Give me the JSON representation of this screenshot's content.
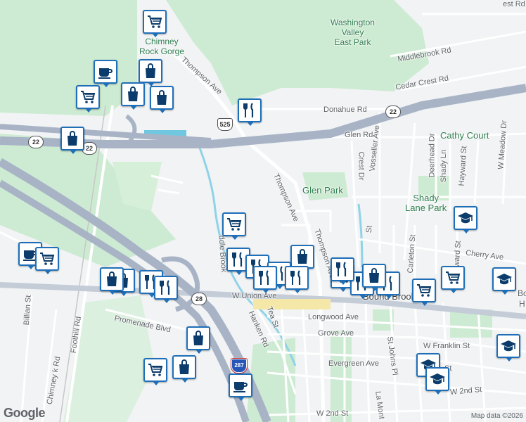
{
  "streets": {
    "thompson_upper": "Thompson Ave",
    "thompson_lower_a": "Thompson Ave",
    "thompson_lower_b": "Thompson Ave",
    "donahue": "Donahue Rd",
    "glen": "Glen Rd",
    "cedar_crest": "Cedar Crest Rd",
    "middlebrook": "Middlebrook Rd",
    "west_rd": "est Rd",
    "vosseller": "Vosseller Ave",
    "crest": "Crest Dr",
    "deerhead": "Deerhead Dr",
    "shady_ln": "Shady Ln",
    "hayward": "Hayward St",
    "w_meadow": "W Meadow Dr",
    "cherry": "Cherry Ave",
    "carleton": "Carleton St",
    "ward": "ward St",
    "w_union": "W Union Ave",
    "tea": "Tea St",
    "hanken": "Hanken Rd",
    "longwood": "Longwood Ave",
    "grove": "Grove Ave",
    "w_franklin": "W Franklin St",
    "evergreen": "Evergreen Ave",
    "st_johns": "St Johns Pl",
    "w_2nd_a": "W 2nd St",
    "w_2nd_b": "W 2nd St",
    "la_mont": "La Mont",
    "st_suffix": "St",
    "promenade": "Promenade Blvd",
    "foothill": "Foothill Rd",
    "chimney_rk": "Chimney k Rd",
    "billian": "Billian St",
    "brook": "ddle Brook",
    "union_w": "W Union Ave"
  },
  "places": {
    "washington_valley": "Washington\nValley\nEast Park",
    "chimney_rock": "Chimney\nRock Gorge",
    "cathy_court": "Cathy Court",
    "glen_park": "Glen Park",
    "shady_lane": "Shady\nLane Park",
    "bound_brook": "Bound Brook",
    "bo": "Bo",
    "h": "H"
  },
  "shields": {
    "r525": "525",
    "r22a": "22",
    "r22b": "22",
    "r22c": "22",
    "r28": "28",
    "i287": "287"
  },
  "footer": {
    "logo": "Google",
    "attribution": "Map data ©2026"
  },
  "pins": [
    {
      "icon": "shopping-cart-icon"
    },
    {
      "icon": "coffee-cup-icon"
    },
    {
      "icon": "shopping-bag-icon"
    },
    {
      "icon": "shopping-cart-icon"
    },
    {
      "icon": "shopping-bag-icon"
    },
    {
      "icon": "shopping-bag-icon"
    },
    {
      "icon": "restaurant-icon"
    },
    {
      "icon": "shopping-bag-icon"
    },
    {
      "icon": "shopping-cart-icon"
    },
    {
      "icon": "restaurant-icon"
    },
    {
      "icon": "restaurant-icon"
    },
    {
      "icon": "shopping-bag-icon"
    },
    {
      "icon": "school-icon"
    },
    {
      "icon": "coffee-cup-icon"
    },
    {
      "icon": "shopping-cart-icon"
    },
    {
      "icon": "shopping-bag-icon"
    },
    {
      "icon": "restaurant-icon"
    },
    {
      "icon": "restaurant-icon"
    },
    {
      "icon": "shopping-cart-icon"
    },
    {
      "icon": "shopping-cart-icon"
    },
    {
      "icon": "school-icon"
    },
    {
      "icon": "school-icon"
    },
    {
      "icon": "school-icon"
    },
    {
      "icon": "coffee-cup-icon"
    },
    {
      "icon": "shopping-cart-icon"
    },
    {
      "icon": "shopping-bag-icon"
    },
    {
      "icon": "shopping-bag-icon"
    }
  ],
  "colors": {
    "park_green": "#cdebd2",
    "highway": "#a8b4c6",
    "pin_border": "#1f6fb8",
    "water": "#8fd3e8"
  }
}
